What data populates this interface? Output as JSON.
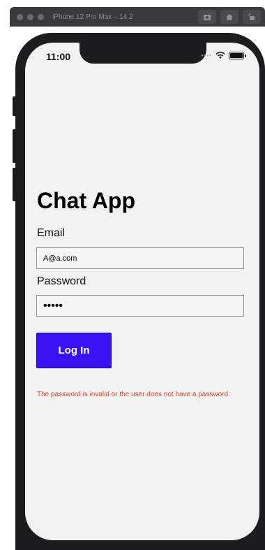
{
  "simulator": {
    "title": "iPhone 12 Pro Max – 14.2",
    "buttons": [
      "screenshot-icon",
      "home-icon",
      "rotate-icon"
    ]
  },
  "status_bar": {
    "time": "11:00",
    "icons": [
      "signal-icon",
      "wifi-icon",
      "battery-icon"
    ]
  },
  "app": {
    "title": "Chat App",
    "email": {
      "label": "Email",
      "value": "A@a.com"
    },
    "password": {
      "label": "Password",
      "value": "•••••"
    },
    "login_button": "Log In",
    "error_message": "The password is invalid or the user does not have a password.",
    "colors": {
      "button": "#3a12f2",
      "error": "#d9452b",
      "background": "#f2f2f2"
    }
  }
}
